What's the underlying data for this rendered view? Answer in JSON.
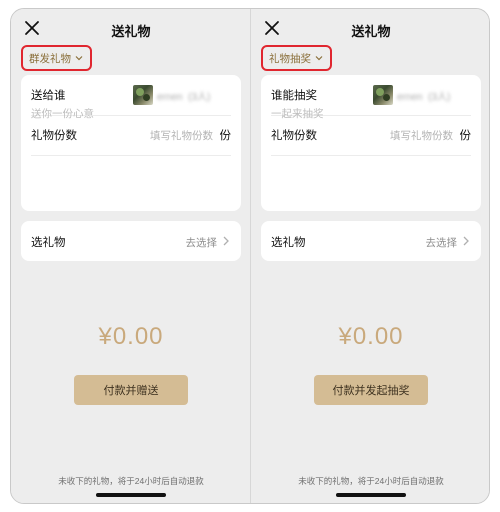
{
  "colors": {
    "background": "#ededed",
    "card": "#ffffff",
    "accent_gold": "#c9a97c",
    "button": "#d4bc94",
    "highlight_border": "#e0262f"
  },
  "panels": [
    {
      "nav_title": "送礼物",
      "close_icon": "close-icon",
      "mode_label": "群发礼物",
      "recipient_label": "送给谁",
      "recipient_name": "ernen  (3人)",
      "quantity_label": "礼物份数",
      "quantity_placeholder": "填写礼物份数",
      "quantity_unit": "份",
      "message_placeholder": "送你一份心意",
      "select_label": "选礼物",
      "select_value": "去选择",
      "amount": "¥0.00",
      "action_button": "付款并赠送",
      "footer_note": "未收下的礼物，将于24小时后自动退款"
    },
    {
      "nav_title": "送礼物",
      "close_icon": "close-icon",
      "mode_label": "礼物抽奖",
      "recipient_label": "谁能抽奖",
      "recipient_name": "ernen  (3人)",
      "quantity_label": "礼物份数",
      "quantity_placeholder": "填写礼物份数",
      "quantity_unit": "份",
      "message_placeholder": "一起来抽奖",
      "select_label": "选礼物",
      "select_value": "去选择",
      "amount": "¥0.00",
      "action_button": "付款并发起抽奖",
      "footer_note": "未收下的礼物，将于24小时后自动退款"
    }
  ]
}
